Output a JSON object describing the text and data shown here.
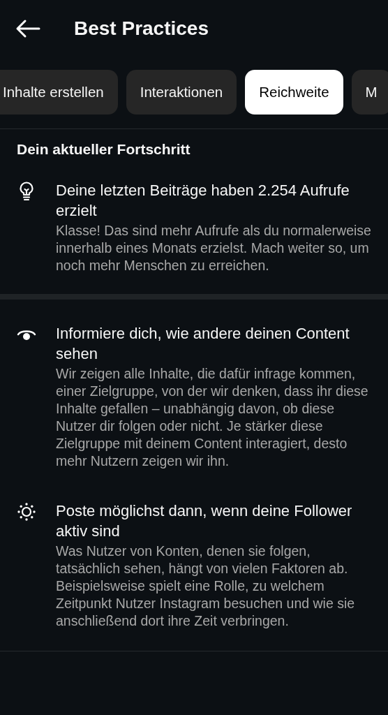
{
  "header": {
    "title": "Best Practices"
  },
  "tabs": [
    {
      "label": "Inhalte erstellen",
      "selected": false
    },
    {
      "label": "Interaktionen",
      "selected": false
    },
    {
      "label": "Reichweite",
      "selected": true
    },
    {
      "label": "M",
      "selected": false
    }
  ],
  "progress": {
    "title": "Dein aktueller Fortschritt",
    "items": [
      {
        "title": "Deine letzten Beiträge haben 2.254 Aufrufe erzielt",
        "body": "Klasse! Das sind mehr Aufrufe als du normalerweise innerhalb eines Monats erzielst. Mach weiter so, um noch mehr Menschen zu erreichen."
      }
    ]
  },
  "tips": [
    {
      "title": "Informiere dich, wie andere deinen Content sehen",
      "body": "Wir zeigen alle Inhalte, die dafür infrage kommen, einer Zielgruppe, von der wir denken, dass ihr diese Inhalte gefallen – unabhängig davon, ob diese Nutzer dir folgen oder nicht. Je stärker diese Zielgruppe mit deinem Content interagiert, desto mehr Nutzern zeigen wir ihn."
    },
    {
      "title": "Poste möglichst dann, wenn deine Follower aktiv sind",
      "body": "Was Nutzer von Konten, denen sie folgen, tatsächlich sehen, hängt von vielen Faktoren ab. Beispielsweise spielt eine Rolle, zu welchem Zeitpunkt Nutzer Instagram besuchen und wie sie anschließend dort ihre Zeit verbringen."
    }
  ]
}
